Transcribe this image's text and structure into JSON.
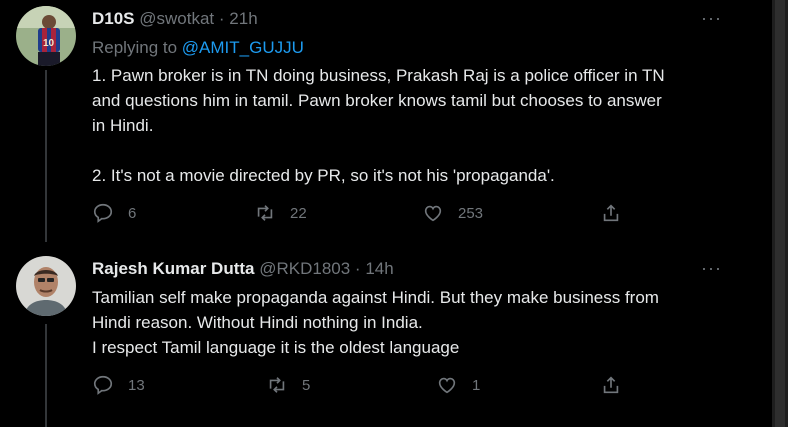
{
  "tweet1": {
    "name": "D10S",
    "handle": "@swotkat",
    "dot": "·",
    "time": "21h",
    "replying_prefix": "Replying to",
    "replying_to": "@AMIT_GUJJU",
    "lines": [
      "1. Pawn broker is in TN doing business, Prakash Raj is a police officer in TN",
      "and questions him in tamil. Pawn broker knows tamil but chooses to answer",
      "in Hindi.",
      "2. It's not a movie directed by PR, so it's not his 'propaganda'."
    ],
    "replies": "6",
    "retweets": "22",
    "likes": "253"
  },
  "tweet2": {
    "name": "Rajesh Kumar Dutta",
    "handle": "@RKD1803",
    "dot": "·",
    "time": "14h",
    "lines": [
      "Tamilian self make propaganda against Hindi.  But they make business from",
      "Hindi reason. Without Hindi nothing in India.",
      "I respect Tamil language  it is the oldest language"
    ],
    "replies": "13",
    "retweets": "5",
    "likes": "1"
  },
  "more_glyph": "···",
  "colors": {
    "background": "#000000",
    "text": "#e7e9ea",
    "muted": "#71767b",
    "link": "#1d9bf0"
  },
  "icons": [
    "reply-icon",
    "retweet-icon",
    "like-icon",
    "share-icon",
    "more-icon"
  ]
}
